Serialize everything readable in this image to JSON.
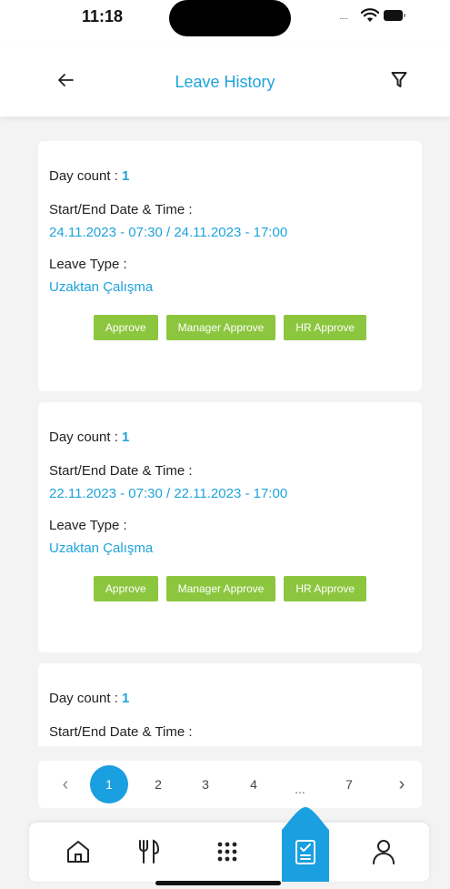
{
  "status_bar": {
    "time": "11:18",
    "signal": "....."
  },
  "header": {
    "title": "Leave History"
  },
  "cards": [
    {
      "day_count_label": "Day count : ",
      "day_count": "1",
      "dates_label": "Start/End Date & Time :",
      "dates": "24.11.2023 - 07:30 / 24.11.2023 - 17:00",
      "leave_type_label": "Leave Type :",
      "leave_type": "Uzaktan Çalışma",
      "buttons": [
        "Approve",
        "Manager Approve",
        "HR Approve"
      ]
    },
    {
      "day_count_label": "Day count : ",
      "day_count": "1",
      "dates_label": "Start/End Date & Time :",
      "dates": "22.11.2023 - 07:30 / 22.11.2023 - 17:00",
      "leave_type_label": "Leave Type :",
      "leave_type": "Uzaktan Çalışma",
      "buttons": [
        "Approve",
        "Manager Approve",
        "HR Approve"
      ]
    },
    {
      "day_count_label": "Day count : ",
      "day_count": "1",
      "dates_label": "Start/End Date & Time :"
    }
  ],
  "pagination": {
    "prev": "‹",
    "current": "1",
    "pages": [
      "2",
      "3",
      "4"
    ],
    "ellipsis": "...",
    "last": "7",
    "next": "›"
  },
  "nav": {
    "items": [
      "home-icon",
      "restaurant-icon",
      "apps-grid-icon",
      "leave-request-icon",
      "profile-icon"
    ],
    "active": "leave-request-icon"
  },
  "colors": {
    "accent": "#1fa3dc",
    "approve_green": "#8cc63f",
    "background": "#f3f3f3"
  }
}
